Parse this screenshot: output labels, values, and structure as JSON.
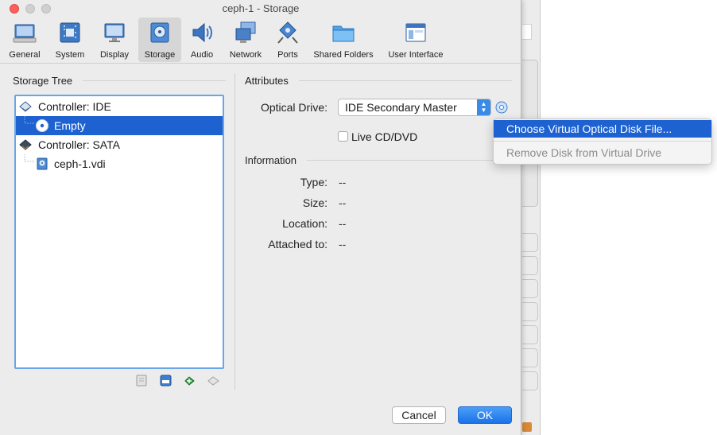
{
  "window": {
    "title": "ceph-1 - Storage"
  },
  "toolbar": {
    "items": [
      {
        "label": "General",
        "icon": "general-icon"
      },
      {
        "label": "System",
        "icon": "system-icon"
      },
      {
        "label": "Display",
        "icon": "display-icon"
      },
      {
        "label": "Storage",
        "icon": "storage-icon",
        "selected": true
      },
      {
        "label": "Audio",
        "icon": "audio-icon"
      },
      {
        "label": "Network",
        "icon": "network-icon"
      },
      {
        "label": "Ports",
        "icon": "ports-icon"
      },
      {
        "label": "Shared Folders",
        "icon": "shared-folders-icon"
      },
      {
        "label": "User Interface",
        "icon": "user-interface-icon"
      }
    ]
  },
  "storage_tree": {
    "title": "Storage Tree",
    "items": [
      {
        "label": "Controller: IDE",
        "type": "controller"
      },
      {
        "label": "Empty",
        "type": "optical",
        "selected": true
      },
      {
        "label": "Controller: SATA",
        "type": "controller"
      },
      {
        "label": "ceph-1.vdi",
        "type": "disk"
      }
    ]
  },
  "attributes": {
    "title": "Attributes",
    "optical_drive_label": "Optical Drive:",
    "optical_drive_value": "IDE Secondary Master",
    "live_cd_label": "Live CD/DVD",
    "live_cd_checked": false
  },
  "information": {
    "title": "Information",
    "type_label": "Type:",
    "type_value": "--",
    "size_label": "Size:",
    "size_value": "--",
    "location_label": "Location:",
    "location_value": "--",
    "attached_label": "Attached to:",
    "attached_value": "--"
  },
  "popup_menu": {
    "choose_label": "Choose Virtual Optical Disk File...",
    "remove_label": "Remove Disk from Virtual Drive"
  },
  "buttons": {
    "cancel": "Cancel",
    "ok": "OK"
  },
  "colors": {
    "accent": "#1d62d0",
    "focus": "#6aa5e6",
    "close": "#fc605c"
  }
}
